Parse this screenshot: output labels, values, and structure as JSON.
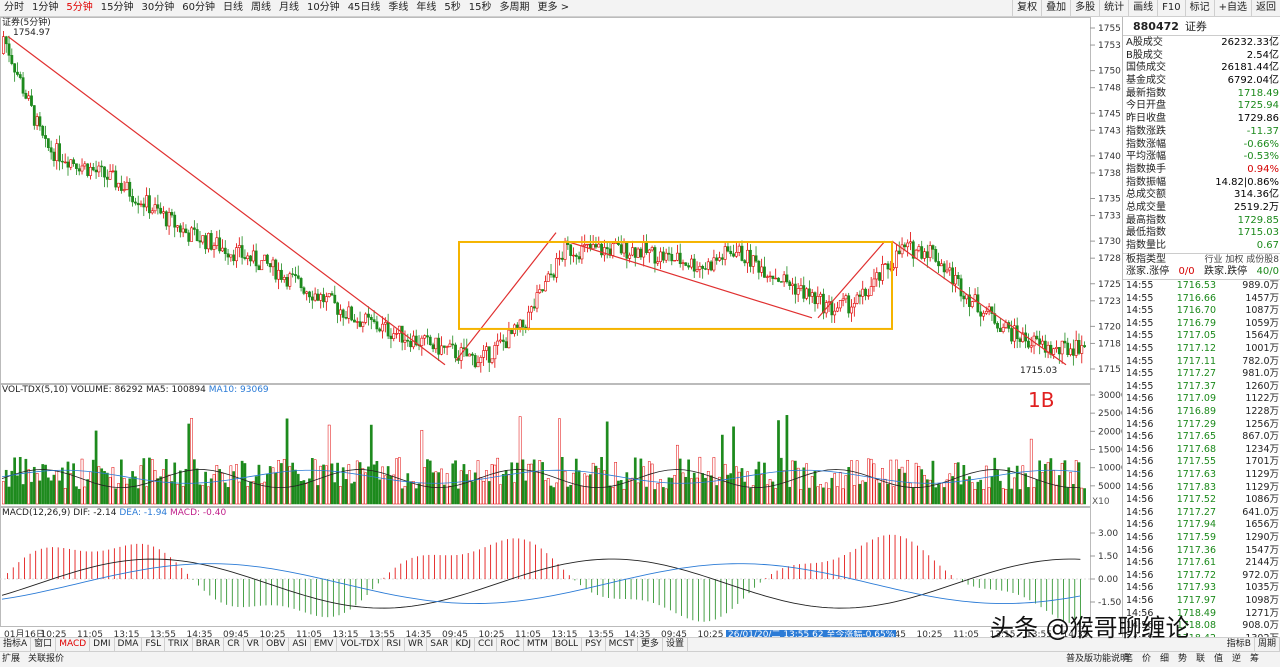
{
  "toolbar": {
    "periods": [
      "分时",
      "1分钟",
      "5分钟",
      "15分钟",
      "30分钟",
      "60分钟",
      "日线",
      "周线",
      "月线",
      "10分钟",
      "45日线",
      "季线",
      "年线",
      "5秒",
      "15秒",
      "多周期",
      "更多 >"
    ],
    "active_period": "5分钟",
    "right_tools": [
      "复权",
      "叠加",
      "多股",
      "统计",
      "画线",
      "F10",
      "标记",
      "+自选",
      "返回"
    ]
  },
  "chart": {
    "title": "证券(5分钟)",
    "price_ticks": [
      "1755",
      "1753",
      "1750",
      "1748",
      "1745",
      "1743",
      "1740",
      "1738",
      "1735",
      "1733",
      "1730",
      "1728",
      "1725",
      "1723",
      "1720",
      "1718",
      "1715"
    ],
    "high_label": "1754.97",
    "low_label": "1715.03",
    "volume_header": {
      "name": "VOL-TDX(5,10)",
      "volume": "VOLUME: 86292",
      "ma5": "MA5: 100894",
      "ma10": "MA10: 93069"
    },
    "volume_ticks": [
      "30000",
      "25000",
      "20000",
      "15000",
      "10000",
      "5000"
    ],
    "volume_unit": "X10",
    "macd_header": {
      "name": "MACD(12,26,9)",
      "dif": "DIF: -2.14",
      "dea": "DEA: -1.94",
      "macd": "MACD: -0.40"
    },
    "macd_ticks": [
      "3.00",
      "1.50",
      "0.00",
      "-1.50"
    ],
    "annotation": "1B",
    "time_axis": [
      "01月16日",
      "10:25",
      "11:05",
      "13:15",
      "13:55",
      "14:35",
      "09:45",
      "10:25",
      "11:05",
      "13:15",
      "13:55",
      "14:35",
      "09:45",
      "10:25",
      "11:05",
      "13:15",
      "13:55",
      "14:35",
      "09:45",
      "10:25",
      "11:05",
      "13:15",
      "13:55",
      "14:35",
      "09:45",
      "10:25",
      "11:05",
      "13:15",
      "13:55",
      "14:35"
    ],
    "cursor_info": "26/01/20/二 13:55 62 至今涨幅-0.65%"
  },
  "colors": {
    "up": "#e00000",
    "down": "#1d8a1d",
    "ma5": "#222222",
    "ma10": "#2b7bd6",
    "box": "#f5b400",
    "trend": "#e03030"
  },
  "panel": {
    "code": "880472",
    "name": "证券",
    "stats": [
      {
        "label": "A股成交",
        "value": "26232.33亿",
        "cls": ""
      },
      {
        "label": "B股成交",
        "value": "2.54亿",
        "cls": ""
      },
      {
        "label": "国债成交",
        "value": "26181.44亿",
        "cls": ""
      },
      {
        "label": "基金成交",
        "value": "6792.04亿",
        "cls": ""
      },
      {
        "label": "最新指数",
        "value": "1718.49",
        "cls": "green"
      },
      {
        "label": "今日开盘",
        "value": "1725.94",
        "cls": "green"
      },
      {
        "label": "昨日收盘",
        "value": "1729.86",
        "cls": ""
      },
      {
        "label": "指数涨跌",
        "value": "-11.37",
        "cls": "green"
      },
      {
        "label": "指数涨幅",
        "value": "-0.66%",
        "cls": "green"
      },
      {
        "label": "平均涨幅",
        "value": "-0.53%",
        "cls": "green"
      },
      {
        "label": "指数换手",
        "value": "0.94%",
        "cls": "red"
      },
      {
        "label": "指数振幅",
        "value": "14.82|0.86%",
        "cls": ""
      },
      {
        "label": "总成交额",
        "value": "314.36亿",
        "cls": ""
      },
      {
        "label": "总成交量",
        "value": "2519.2万",
        "cls": ""
      },
      {
        "label": "最高指数",
        "value": "1729.85",
        "cls": "green"
      },
      {
        "label": "最低指数",
        "value": "1715.03",
        "cls": "green"
      },
      {
        "label": "指数量比",
        "value": "0.67",
        "cls": "green"
      }
    ],
    "sector_type_label": "板指类型",
    "sector_types": "行业 加权 成份股8",
    "updown_label": "涨家.涨停",
    "updown_value": "0/0",
    "down_label": "跌家.跌停",
    "down_value": "40/0",
    "ticks": [
      [
        "14:55",
        "1716.53",
        "989.0万"
      ],
      [
        "14:55",
        "1716.66",
        "1457万"
      ],
      [
        "14:55",
        "1716.70",
        "1087万"
      ],
      [
        "14:55",
        "1716.79",
        "1059万"
      ],
      [
        "14:55",
        "1717.05",
        "1564万"
      ],
      [
        "14:55",
        "1717.12",
        "1001万"
      ],
      [
        "14:55",
        "1717.11",
        "782.0万"
      ],
      [
        "14:55",
        "1717.27",
        "981.0万"
      ],
      [
        "14:55",
        "1717.37",
        "1260万"
      ],
      [
        "14:56",
        "1717.09",
        "1122万"
      ],
      [
        "14:56",
        "1716.89",
        "1228万"
      ],
      [
        "14:56",
        "1717.29",
        "1256万"
      ],
      [
        "14:56",
        "1717.65",
        "867.0万"
      ],
      [
        "14:56",
        "1717.68",
        "1234万"
      ],
      [
        "14:56",
        "1717.55",
        "1701万"
      ],
      [
        "14:56",
        "1717.63",
        "1129万"
      ],
      [
        "14:56",
        "1717.83",
        "1129万"
      ],
      [
        "14:56",
        "1717.52",
        "1086万"
      ],
      [
        "14:56",
        "1717.27",
        "641.0万"
      ],
      [
        "14:56",
        "1717.94",
        "1656万"
      ],
      [
        "14:56",
        "1717.59",
        "1290万"
      ],
      [
        "14:56",
        "1717.36",
        "1547万"
      ],
      [
        "14:56",
        "1717.61",
        "2144万"
      ],
      [
        "14:56",
        "1717.72",
        "972.0万"
      ],
      [
        "14:56",
        "1717.93",
        "1035万"
      ],
      [
        "14:56",
        "1717.97",
        "1098万"
      ],
      [
        "14:56",
        "1718.49",
        "1271万"
      ],
      [
        "14:56",
        "1718.08",
        "908.0万"
      ],
      [
        "14:56",
        "1718.42",
        "1302万"
      ],
      [
        "14:56",
        "1718.77",
        "877.0万"
      ]
    ]
  },
  "bottom_tabs": [
    "指标A",
    "窗口",
    "MACD",
    "DMI",
    "DMA",
    "FSL",
    "TRIX",
    "BRAR",
    "CR",
    "VR",
    "OBV",
    "ASI",
    "EMV",
    "VOL-TDX",
    "RSI",
    "WR",
    "SAR",
    "KDJ",
    "CCI",
    "ROC",
    "MTM",
    "BOLL",
    "PSY",
    "MCST",
    "更多",
    "设置"
  ],
  "bottom_tabs_right": [
    "指标B",
    "周期"
  ],
  "status_left": [
    "扩展",
    "关联报价"
  ],
  "status_right": [
    "普及版功能说明",
    "笔",
    "价",
    "细",
    "势",
    "联",
    "值",
    "逆",
    "筹"
  ],
  "watermark": "头条 @猴哥聊缠论"
}
